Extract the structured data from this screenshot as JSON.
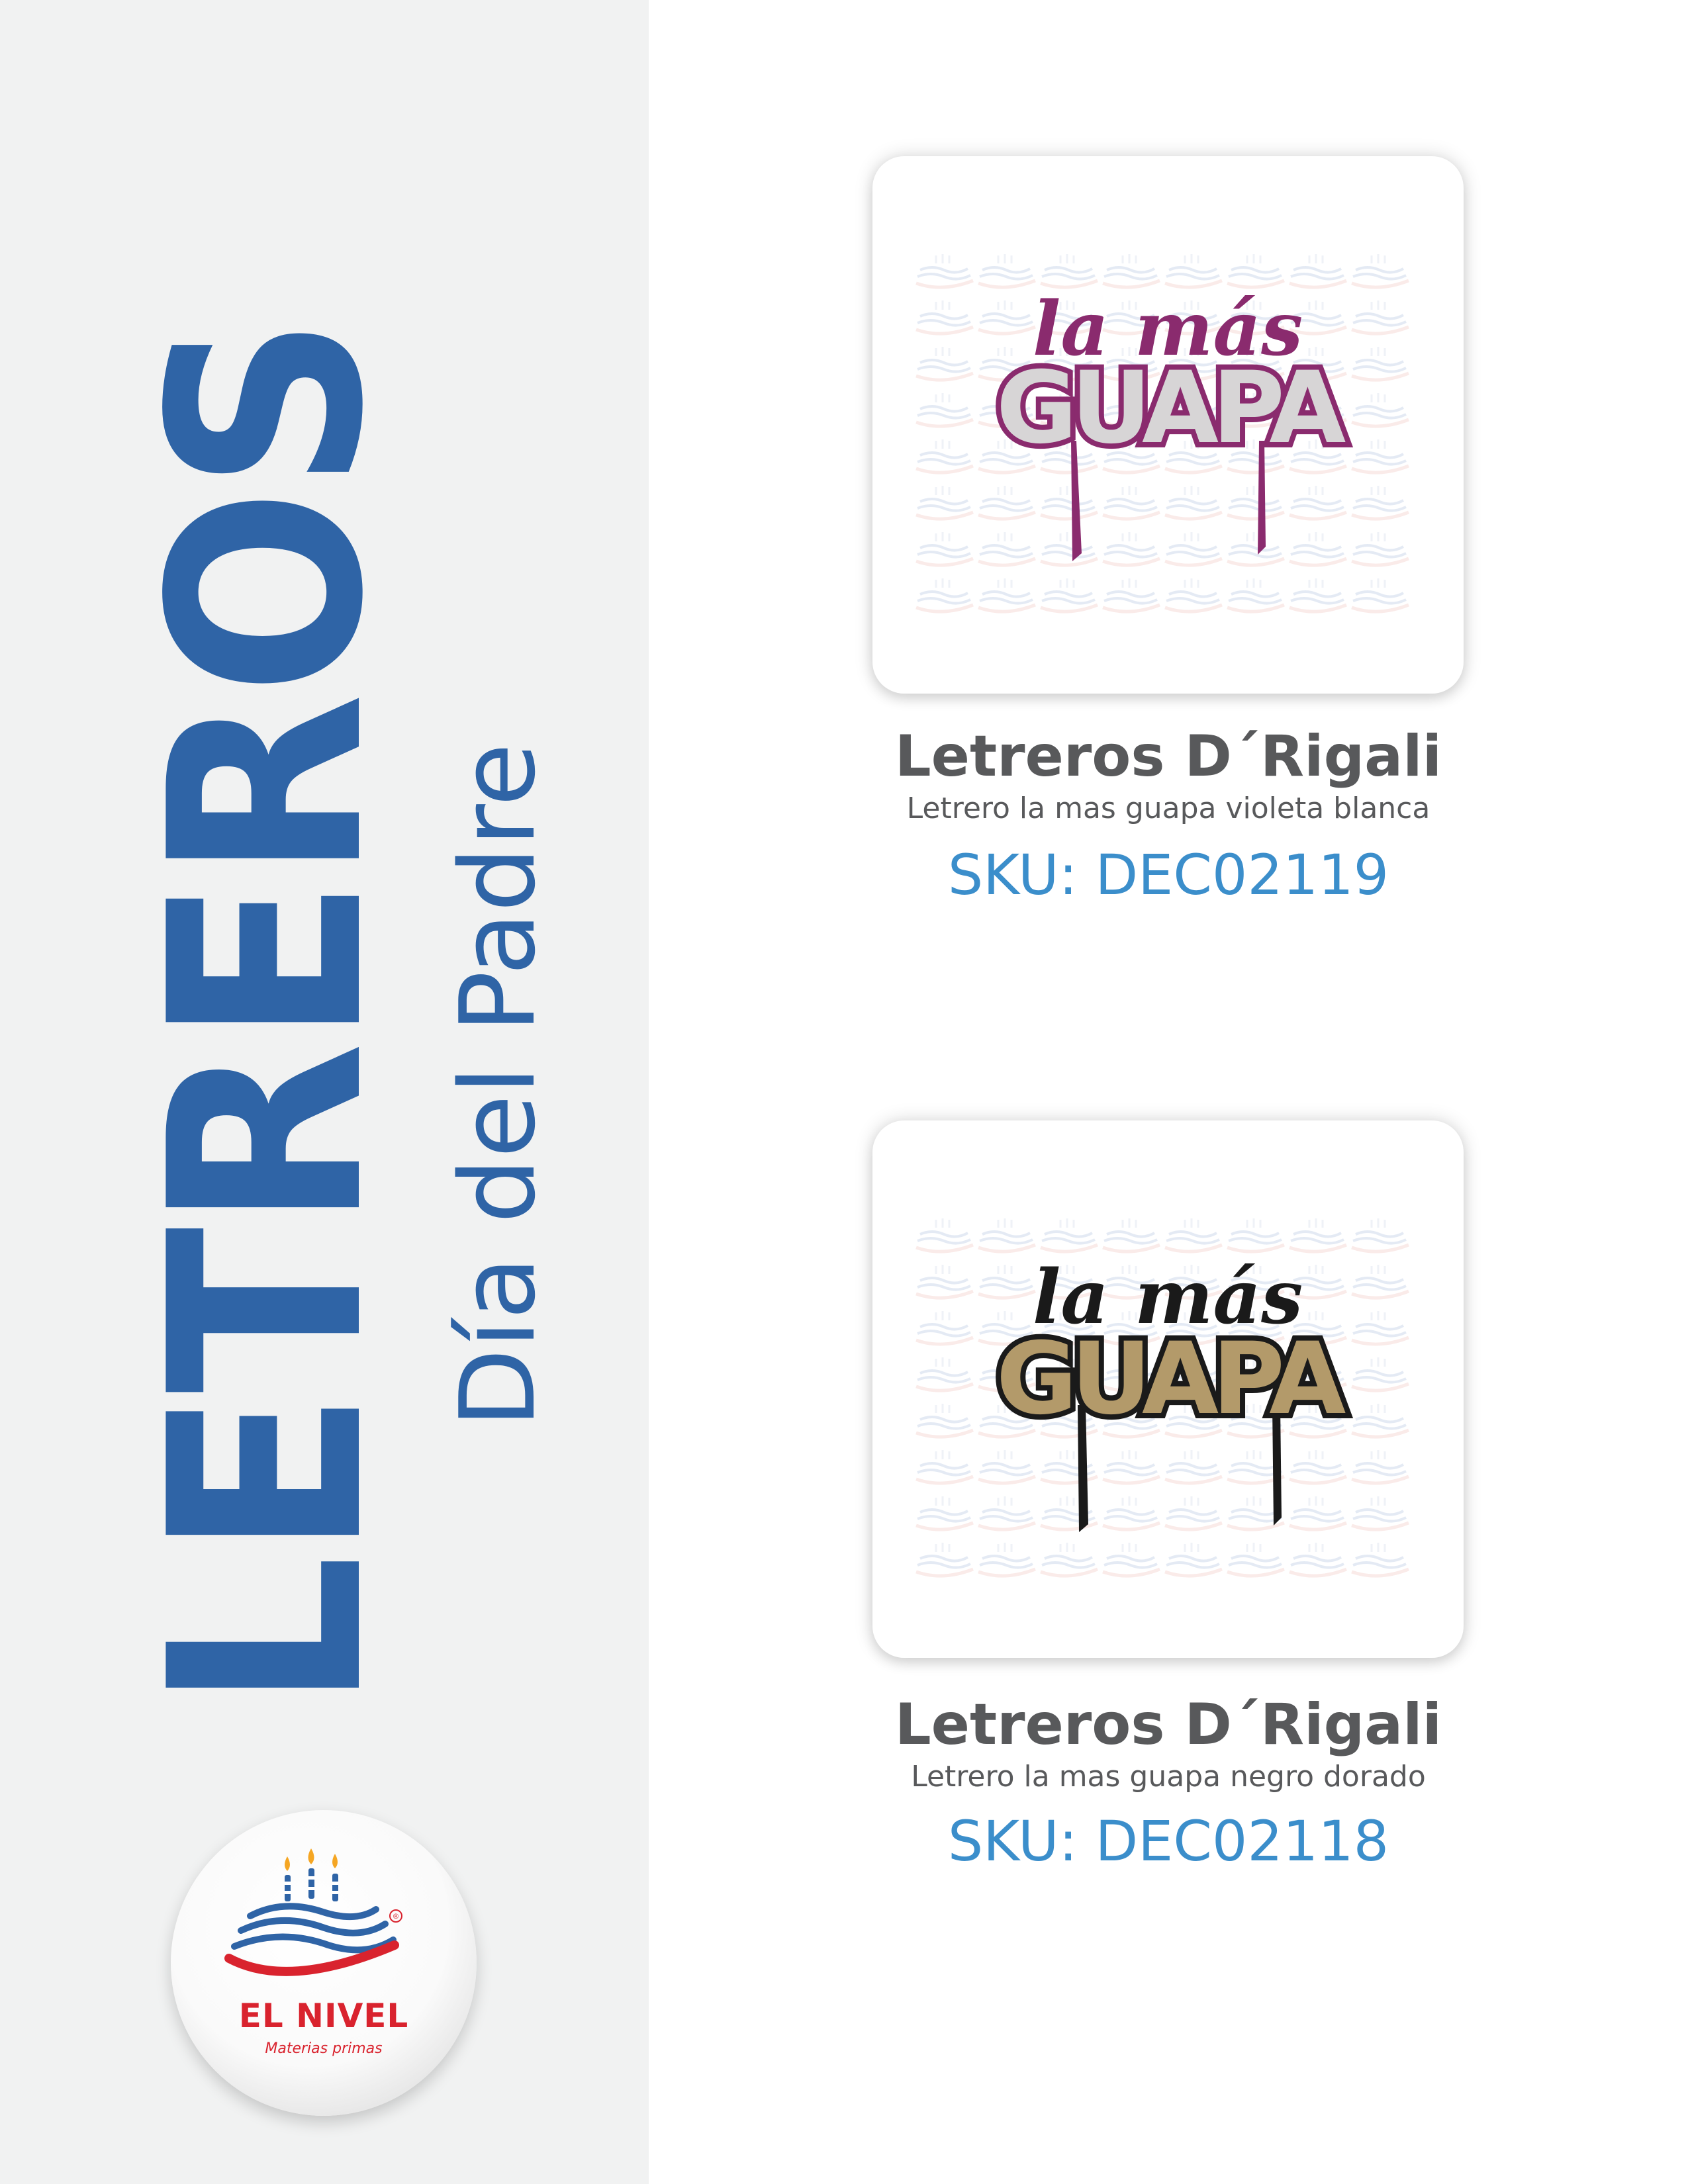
{
  "sidebar": {
    "title": "LETREROS",
    "subtitle": "Día del Padre"
  },
  "brand": {
    "name": "EL NIVEL",
    "tagline": "Materias primas",
    "registered_mark": "®",
    "color_red": "#d9232e",
    "color_blue": "#2f64a6"
  },
  "products": [
    {
      "image_text_top": "la más",
      "image_text_bottom": "GUAPA",
      "name": "Letreros D´Rigali",
      "description": "Letrero la mas guapa violeta blanca",
      "sku": "SKU: DEC02119",
      "colors": {
        "script": "#8a2b6e",
        "block_fill": "#d7d5d6",
        "block_outline": "#8a2b6e"
      }
    },
    {
      "image_text_top": "la más",
      "image_text_bottom": "GUAPA",
      "name": "Letreros D´Rigali",
      "description": "Letrero la mas guapa negro dorado",
      "sku": "SKU: DEC02118",
      "colors": {
        "script": "#1a1a1a",
        "block_fill": "#b39a6a",
        "block_outline": "#1a1a1a"
      }
    }
  ],
  "colors": {
    "sidebar_bg": "#f1f2f2",
    "title_blue": "#2f64a6",
    "text_gray": "#58595b",
    "sku_blue": "#3b8ecb"
  }
}
